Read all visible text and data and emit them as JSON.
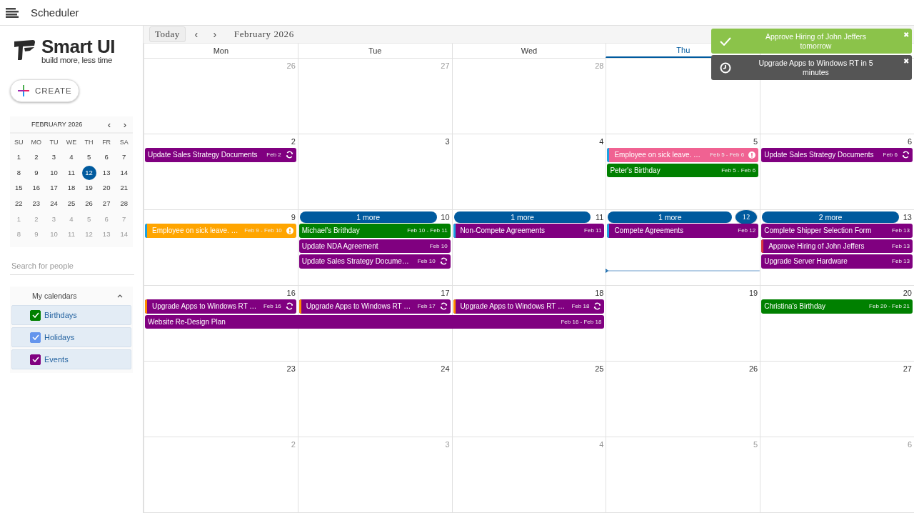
{
  "app_bar": {
    "title": "Scheduler"
  },
  "logo": {
    "name": "Smart UI",
    "tagline": "build more, less time"
  },
  "create_button": {
    "label": "CREATE"
  },
  "mini_calendar": {
    "title": "FEBRUARY 2026",
    "prev": "‹",
    "next": "›",
    "weekdays": [
      "SU",
      "MO",
      "TU",
      "WE",
      "TH",
      "FR",
      "SA"
    ],
    "weeks": [
      [
        {
          "d": "1",
          "muted": false,
          "selected": false
        },
        {
          "d": "2",
          "muted": false,
          "selected": false
        },
        {
          "d": "3",
          "muted": false,
          "selected": false
        },
        {
          "d": "4",
          "muted": false,
          "selected": false
        },
        {
          "d": "5",
          "muted": false,
          "selected": false
        },
        {
          "d": "6",
          "muted": false,
          "selected": false
        },
        {
          "d": "7",
          "muted": false,
          "selected": false
        }
      ],
      [
        {
          "d": "8",
          "muted": false,
          "selected": false
        },
        {
          "d": "9",
          "muted": false,
          "selected": false
        },
        {
          "d": "10",
          "muted": false,
          "selected": false
        },
        {
          "d": "11",
          "muted": false,
          "selected": false
        },
        {
          "d": "12",
          "muted": false,
          "selected": true
        },
        {
          "d": "13",
          "muted": false,
          "selected": false
        },
        {
          "d": "14",
          "muted": false,
          "selected": false
        }
      ],
      [
        {
          "d": "15",
          "muted": false,
          "selected": false
        },
        {
          "d": "16",
          "muted": false,
          "selected": false
        },
        {
          "d": "17",
          "muted": false,
          "selected": false
        },
        {
          "d": "18",
          "muted": false,
          "selected": false
        },
        {
          "d": "19",
          "muted": false,
          "selected": false
        },
        {
          "d": "20",
          "muted": false,
          "selected": false
        },
        {
          "d": "21",
          "muted": false,
          "selected": false
        }
      ],
      [
        {
          "d": "22",
          "muted": false,
          "selected": false
        },
        {
          "d": "23",
          "muted": false,
          "selected": false
        },
        {
          "d": "24",
          "muted": false,
          "selected": false
        },
        {
          "d": "25",
          "muted": false,
          "selected": false
        },
        {
          "d": "26",
          "muted": false,
          "selected": false
        },
        {
          "d": "27",
          "muted": false,
          "selected": false
        },
        {
          "d": "28",
          "muted": false,
          "selected": false
        }
      ],
      [
        {
          "d": "1",
          "muted": true,
          "selected": false
        },
        {
          "d": "2",
          "muted": true,
          "selected": false
        },
        {
          "d": "3",
          "muted": true,
          "selected": false
        },
        {
          "d": "4",
          "muted": true,
          "selected": false
        },
        {
          "d": "5",
          "muted": true,
          "selected": false
        },
        {
          "d": "6",
          "muted": true,
          "selected": false
        },
        {
          "d": "7",
          "muted": true,
          "selected": false
        }
      ],
      [
        {
          "d": "8",
          "muted": true,
          "selected": false
        },
        {
          "d": "9",
          "muted": true,
          "selected": false
        },
        {
          "d": "10",
          "muted": true,
          "selected": false
        },
        {
          "d": "11",
          "muted": true,
          "selected": false
        },
        {
          "d": "12",
          "muted": true,
          "selected": false
        },
        {
          "d": "13",
          "muted": true,
          "selected": false
        },
        {
          "d": "14",
          "muted": true,
          "selected": false
        }
      ]
    ]
  },
  "people_search": {
    "placeholder": "Search for people"
  },
  "calendars": {
    "title": "My calendars",
    "expanded": true,
    "items": [
      {
        "label": "Birthdays",
        "checked": true,
        "color": "#008000"
      },
      {
        "label": "Holidays",
        "checked": true,
        "color": "#6495ed"
      },
      {
        "label": "Events",
        "checked": true,
        "color": "#800080"
      }
    ]
  },
  "toolbar": {
    "today": "Today",
    "prev": "‹",
    "next": "›",
    "date": "February 2026"
  },
  "columns": [
    {
      "label": "Mon",
      "selected": false
    },
    {
      "label": "Tue",
      "selected": false
    },
    {
      "label": "Wed",
      "selected": false
    },
    {
      "label": "Thu",
      "selected": true
    },
    {
      "selected": false
    }
  ],
  "weeks": [
    {
      "days": [
        {
          "d": "26",
          "muted": true,
          "today": false
        },
        {
          "d": "27",
          "muted": true,
          "today": false
        },
        {
          "d": "28",
          "muted": true,
          "today": false
        },
        {
          "today": false
        },
        {
          "today": false
        }
      ]
    },
    {
      "days": [
        {
          "d": "2",
          "muted": false,
          "today": false,
          "events": [
            {
              "title": "Update Sales Strategy Documents",
              "dates": "Feb 2",
              "kind": "recurring",
              "color": "#800080"
            }
          ]
        },
        {
          "d": "3",
          "muted": false,
          "today": false
        },
        {
          "d": "4",
          "muted": false,
          "today": false
        },
        {
          "d": "5",
          "muted": false,
          "today": false,
          "events": [
            {
              "title": "Employee on sick leave. …",
              "dates": "Feb 5 - Feb 6",
              "kind": "important",
              "color": "#f06292",
              "accent": {
                "color": "#1ba1e2"
              }
            },
            {
              "title": "Peter's Birthday",
              "dates": "Feb 5 - Feb 6",
              "kind": "plain",
              "color": "#008000"
            }
          ]
        },
        {
          "d": "6",
          "muted": false,
          "today": false,
          "events": [
            {
              "title": "Update Sales Strategy Documents",
              "dates": "Feb 6",
              "kind": "recurring",
              "color": "#800080"
            }
          ]
        }
      ]
    },
    {
      "days": [
        {
          "d": "9",
          "muted": false,
          "today": false,
          "events": [
            {
              "title": "Employee on sick leave. …",
              "dates": "Feb 9 - Feb 10",
              "kind": "important",
              "color": "#ffa500",
              "accent": {
                "color": "#1ba1e2"
              }
            }
          ]
        },
        {
          "d": "10",
          "muted": false,
          "today": false,
          "more": "1 more",
          "events": [
            {
              "title": "Michael's Brithday",
              "dates": "Feb 10 - Feb 11",
              "kind": "plain",
              "color": "#008000"
            },
            {
              "title": "Update NDA Agreement",
              "dates": "Feb 10",
              "kind": "plain",
              "color": "#800080"
            },
            {
              "title": "Update Sales Strategy Docume…",
              "dates": "Feb 10",
              "kind": "recurring",
              "color": "#800080"
            }
          ]
        },
        {
          "d": "11",
          "muted": false,
          "today": false,
          "more": "1 more",
          "events": [
            {
              "title": "Non-Compete Agreements",
              "dates": "Feb 11",
              "kind": "plain",
              "color": "#800080",
              "accent": {
                "color": "#1ba1e2"
              }
            }
          ]
        },
        {
          "d": "12",
          "muted": false,
          "today": true,
          "more": "1 more",
          "events": [
            {
              "title": "Compete Agreements",
              "dates": "Feb 12",
              "kind": "plain",
              "color": "#800080",
              "accent": {
                "color": "#1ba1e2"
              }
            }
          ]
        },
        {
          "d": "13",
          "muted": false,
          "today": false,
          "more": "2 more",
          "events": [
            {
              "title": "Complete Shipper Selection Form",
              "dates": "Feb 13",
              "kind": "plain",
              "color": "#800080"
            },
            {
              "title": "Approve Hiring of John Jeffers",
              "dates": "Feb 13",
              "kind": "plain",
              "color": "#800080",
              "accent": {
                "color": "#d9363e"
              }
            },
            {
              "title": "Upgrade Server Hardware",
              "dates": "Feb 13",
              "kind": "plain",
              "color": "#800080"
            }
          ]
        }
      ]
    },
    {
      "days": [
        {
          "d": "16",
          "muted": false,
          "today": false,
          "events": [
            {
              "title": "Upgrade Apps to Windows RT …",
              "dates": "Feb 16",
              "kind": "recurring",
              "color": "#800080",
              "accent": {
                "color": "#ff8c00"
              }
            },
            {
              "title": "Website Re-Design Plan",
              "dates": "Feb 16 - Feb 18",
              "kind": "plain",
              "color": "#800080"
            }
          ]
        },
        {
          "d": "17",
          "muted": false,
          "today": false,
          "events": [
            {
              "title": "Upgrade Apps to Windows RT …",
              "dates": "Feb 17",
              "kind": "recurring",
              "color": "#800080",
              "accent": {
                "color": "#ff8c00"
              }
            }
          ]
        },
        {
          "d": "18",
          "muted": false,
          "today": false,
          "events": [
            {
              "title": "Upgrade Apps to Windows RT …",
              "dates": "Feb 18",
              "kind": "recurring",
              "color": "#800080",
              "accent": {
                "color": "#ff8c00"
              }
            }
          ]
        },
        {
          "d": "19",
          "muted": false,
          "today": false
        },
        {
          "d": "20",
          "muted": false,
          "today": false,
          "events": [
            {
              "title": "Christina's Birthday",
              "dates": "Feb 20 - Feb 21",
              "kind": "plain",
              "color": "#008000"
            }
          ]
        }
      ]
    },
    {
      "days": [
        {
          "d": "23",
          "muted": false,
          "today": false
        },
        {
          "d": "24",
          "muted": false,
          "today": false
        },
        {
          "d": "25",
          "muted": false,
          "today": false
        },
        {
          "d": "26",
          "muted": false,
          "today": false
        },
        {
          "d": "27",
          "muted": false,
          "today": false
        }
      ]
    },
    {
      "days": [
        {
          "d": "2",
          "muted": true,
          "today": false
        },
        {
          "d": "3",
          "muted": true,
          "today": false
        },
        {
          "d": "4",
          "muted": true,
          "today": false
        },
        {
          "d": "5",
          "muted": true,
          "today": false
        },
        {
          "d": "6",
          "muted": true,
          "today": false
        }
      ]
    }
  ],
  "toasts": [
    {
      "kind": "success",
      "text": "Approve Hiring of John Jeffers tomorrow",
      "close": "✖"
    },
    {
      "kind": "reminder",
      "text": "Upgrade Apps to Windows RT in 5 minutes",
      "close": "✖"
    }
  ]
}
